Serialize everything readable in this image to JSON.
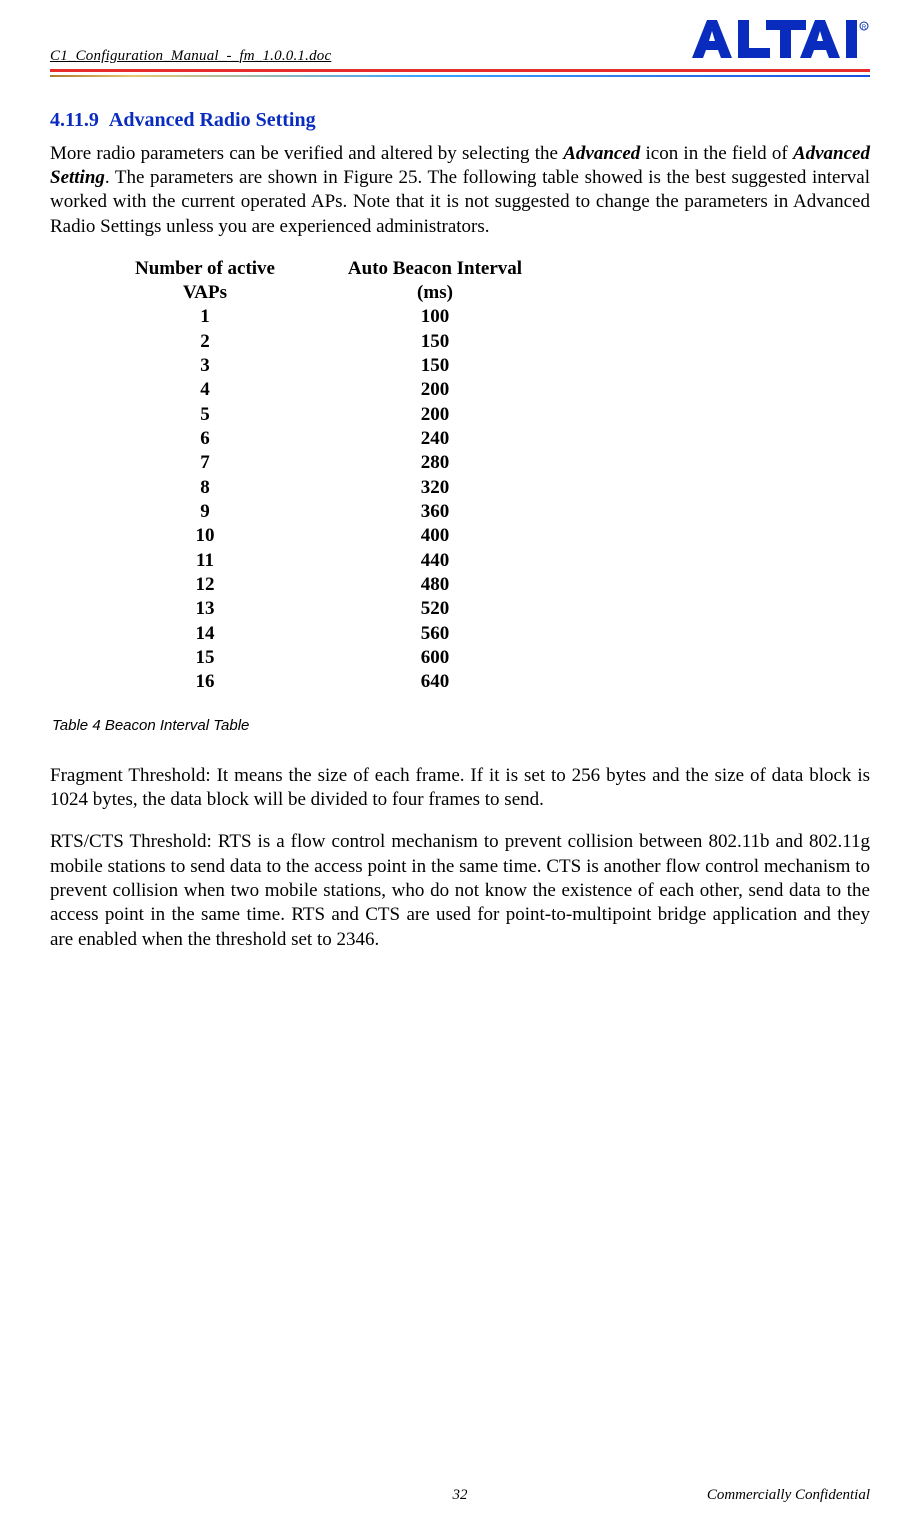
{
  "header": {
    "doc_title": "C1_Configuration_Manual_-_fm_1.0.0.1.doc",
    "logo_text": "ALTAI"
  },
  "section": {
    "number": "4.11.9",
    "title": "Advanced Radio Setting"
  },
  "paragraphs": {
    "intro_part1": "More radio parameters can be verified and altered by selecting the ",
    "intro_em1": "Advanced",
    "intro_part2": " icon in the field of ",
    "intro_em2": "Advanced Setting",
    "intro_part3": ". The parameters are shown in Figure 25. The following table showed is the best suggested interval worked with the current operated APs. Note that it is not suggested to change the parameters in Advanced Radio Settings unless you are experienced administrators.",
    "fragment": "Fragment Threshold: It means the size of each frame. If it is set to 256 bytes and the size of data block is 1024 bytes, the data block will be divided to four frames to send.",
    "rtscts": "RTS/CTS Threshold: RTS is a flow control mechanism to prevent collision between 802.11b and 802.11g mobile stations to send data to the access point in the same time. CTS is another flow control mechanism to prevent collision when two mobile stations, who do not know the existence of each other, send data to the access point in the same time. RTS and CTS are used for point-to-multipoint bridge application and they are enabled when the threshold set to 2346."
  },
  "table": {
    "headers": {
      "col1_line1": "Number of active",
      "col1_line2": "VAPs",
      "col2_line1": "Auto Beacon Interval",
      "col2_line2": "(ms)"
    },
    "rows": [
      {
        "vap": "1",
        "interval": "100"
      },
      {
        "vap": "2",
        "interval": "150"
      },
      {
        "vap": "3",
        "interval": "150"
      },
      {
        "vap": "4",
        "interval": "200"
      },
      {
        "vap": "5",
        "interval": "200"
      },
      {
        "vap": "6",
        "interval": "240"
      },
      {
        "vap": "7",
        "interval": "280"
      },
      {
        "vap": "8",
        "interval": "320"
      },
      {
        "vap": "9",
        "interval": "360"
      },
      {
        "vap": "10",
        "interval": "400"
      },
      {
        "vap": "11",
        "interval": "440"
      },
      {
        "vap": "12",
        "interval": "480"
      },
      {
        "vap": "13",
        "interval": "520"
      },
      {
        "vap": "14",
        "interval": "560"
      },
      {
        "vap": "15",
        "interval": "600"
      },
      {
        "vap": "16",
        "interval": "640"
      }
    ],
    "caption": "Table 4    Beacon Interval Table"
  },
  "footer": {
    "page_number": "32",
    "confidential": "Commercially Confidential"
  }
}
